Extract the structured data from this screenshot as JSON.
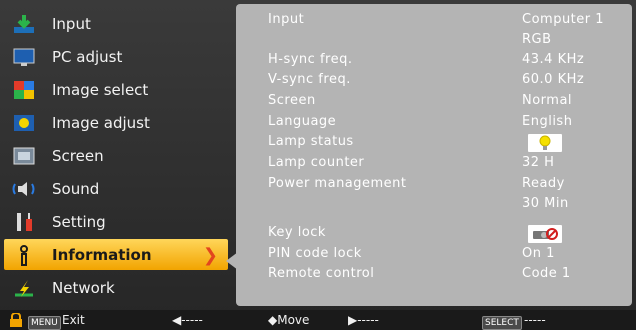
{
  "sidebar": {
    "items": [
      {
        "label": "Input",
        "icon": "input-arrow-icon"
      },
      {
        "label": "PC adjust",
        "icon": "monitor-icon"
      },
      {
        "label": "Image select",
        "icon": "image-select-icon"
      },
      {
        "label": "Image adjust",
        "icon": "image-adjust-icon"
      },
      {
        "label": "Screen",
        "icon": "screen-icon"
      },
      {
        "label": "Sound",
        "icon": "speaker-icon"
      },
      {
        "label": "Setting",
        "icon": "setting-icon"
      },
      {
        "label": "Information",
        "icon": "information-icon",
        "selected": true
      },
      {
        "label": "Network",
        "icon": "network-icon"
      }
    ]
  },
  "info": {
    "input": {
      "label": "Input",
      "value": "Computer 1"
    },
    "input2": {
      "value": "RGB"
    },
    "hsync": {
      "label": "H-sync freq.",
      "value": "43.4  KHz"
    },
    "vsync": {
      "label": "V-sync freq.",
      "value": "60.0  KHz"
    },
    "screen": {
      "label": "Screen",
      "value": "Normal"
    },
    "language": {
      "label": "Language",
      "value": "English"
    },
    "lamp_status": {
      "label": "Lamp status",
      "icon": "lamp-bulb-icon"
    },
    "lamp_counter": {
      "label": "Lamp counter",
      "value": "32  H"
    },
    "power": {
      "label": "Power management",
      "value": "Ready"
    },
    "power2": {
      "value": "30  Min"
    },
    "key_lock": {
      "label": "Key lock",
      "icon": "projector-lock-icon"
    },
    "pin_lock": {
      "label": "PIN code lock",
      "value": "On 1"
    },
    "remote": {
      "label": "Remote control",
      "value": "Code 1"
    }
  },
  "footer": {
    "menu_badge": "MENU",
    "exit": "Exit",
    "left_arrow": "◀-----",
    "move": "◆Move",
    "right_arrow": "▶-----",
    "select_badge": "SELECT",
    "select_dashes": "-----"
  },
  "colors": {
    "selected_bg": "#f2a400",
    "panel_bg": "#b4b4b4",
    "arrow": "#e2461e"
  }
}
